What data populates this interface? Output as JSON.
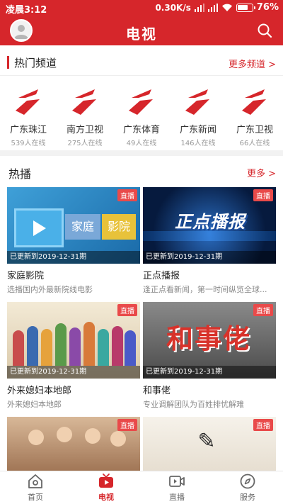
{
  "status_bar": {
    "time": "凌晨3:12",
    "speed": "0.30K/s",
    "battery": "76%",
    "battery_level": 0.76
  },
  "header": {
    "title": "电视"
  },
  "hot_channels": {
    "title": "热门频道",
    "more": "更多频道 >",
    "items": [
      {
        "name": "广东珠江",
        "online": "539人在线"
      },
      {
        "name": "南方卫视",
        "online": "275人在线"
      },
      {
        "name": "广东体育",
        "online": "49人在线"
      },
      {
        "name": "广东新闻",
        "online": "146人在线"
      },
      {
        "name": "广东卫视",
        "online": "66人在线"
      }
    ]
  },
  "hot_play": {
    "title": "热播",
    "more": "更多 >",
    "cards": [
      {
        "badge": "直播",
        "updated": "已更新到2019-12-31期",
        "title": "家庭影院",
        "desc": "选播国内外最新院线电影",
        "thumb_text": "家庭影院"
      },
      {
        "badge": "直播",
        "updated": "已更新到2019-12-31期",
        "title": "正点播报",
        "desc": "逢正点看新闻，第一时间纵览全球...",
        "thumb_text": "正点播报"
      },
      {
        "badge": "直播",
        "updated": "已更新到2019-12-31期",
        "title": "外来媳妇本地郎",
        "desc": "外来媳妇本地郎",
        "thumb_text": ""
      },
      {
        "badge": "直播",
        "updated": "已更新到2019-12-31期",
        "title": "和事佬",
        "desc": "专业调解团队为百姓排忧解难",
        "thumb_text": "和事佬"
      },
      {
        "badge": "直播",
        "updated": "",
        "title": "",
        "desc": "",
        "thumb_text": ""
      },
      {
        "badge": "直播",
        "updated": "",
        "title": "",
        "desc": "",
        "thumb_text": ""
      }
    ]
  },
  "bottom_nav": {
    "items": [
      {
        "label": "首页",
        "icon": "home-icon"
      },
      {
        "label": "电视",
        "icon": "tv-play-icon"
      },
      {
        "label": "直播",
        "icon": "live-video-icon"
      },
      {
        "label": "服务",
        "icon": "compass-icon"
      }
    ],
    "active_index": 1
  },
  "colors": {
    "brand_red": "#d6262b",
    "badge_red": "#e94a4a"
  }
}
